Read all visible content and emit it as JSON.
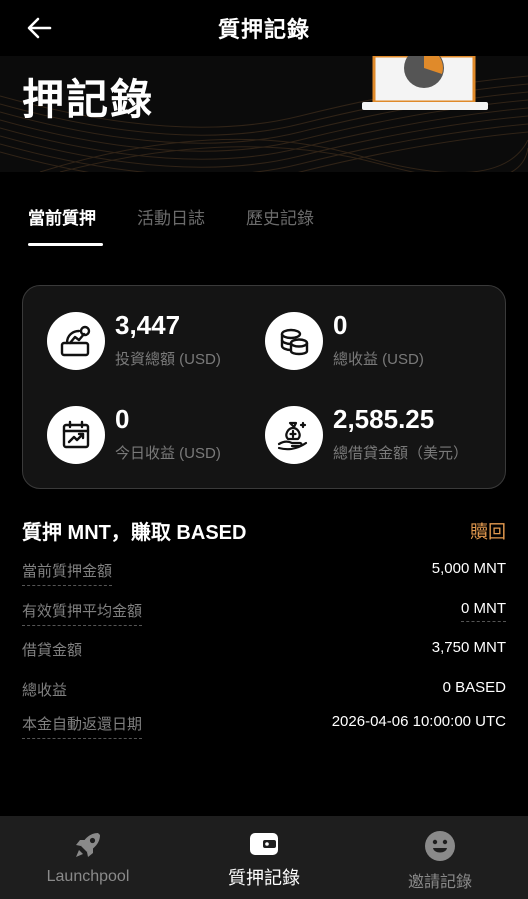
{
  "header": {
    "title": "質押記錄",
    "back_icon": "arrow-left-icon"
  },
  "hero": {
    "title": "押記錄"
  },
  "tabs": [
    {
      "label": "當前質押",
      "active": true
    },
    {
      "label": "活動日誌",
      "active": false
    },
    {
      "label": "歷史記錄",
      "active": false
    }
  ],
  "stats": [
    {
      "value": "3,447",
      "label": "投資總額 (USD)",
      "icon": "investment-icon"
    },
    {
      "value": "0",
      "label": "總收益 (USD)",
      "icon": "coins-icon"
    },
    {
      "value": "0",
      "label": "今日收益 (USD)",
      "icon": "calendar-chart-icon"
    },
    {
      "value": "2,585.25",
      "label": "總借貸金額（美元）",
      "icon": "money-bag-hand-icon"
    }
  ],
  "section": {
    "title": "質押 MNT，賺取 BASED",
    "redeem_label": "贖回"
  },
  "details": [
    {
      "label": "當前質押金額",
      "value": "5,000 MNT"
    },
    {
      "label": "有效質押平均金額",
      "value": "0 MNT"
    },
    {
      "label": "借貸金額",
      "value": "3,750 MNT"
    },
    {
      "label": "總收益",
      "value": "0 BASED"
    },
    {
      "label": "本金自動返還日期",
      "value": "2026-04-06 10:00:00 UTC"
    }
  ],
  "bottom_nav": [
    {
      "label": "Launchpool",
      "icon": "rocket-icon",
      "active": false
    },
    {
      "label": "質押記錄",
      "icon": "wallet-icon",
      "active": true
    },
    {
      "label": "邀請記錄",
      "icon": "smiley-icon",
      "active": false
    }
  ],
  "colors": {
    "background": "#000000",
    "card": "#141414",
    "accent_orange": "#e39a4f",
    "nav_bg": "#1e1e1e"
  }
}
